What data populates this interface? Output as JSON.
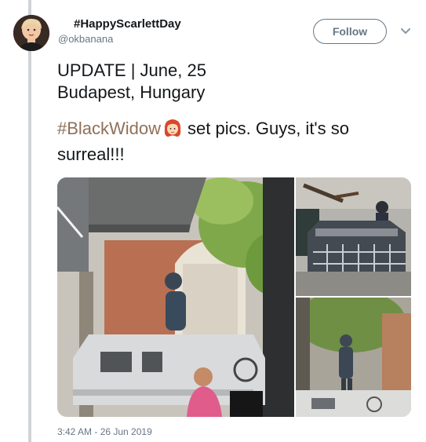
{
  "author": {
    "display_name": "#HappyScarlettDay",
    "handle": "@okbanana"
  },
  "follow_button": {
    "label": "Follow"
  },
  "tweet": {
    "line1": "UPDATE | June, 25",
    "line2": "Budapest, Hungary",
    "hashtag": "#BlackWidow",
    "line3_rest": "set pics. Guys, it's so",
    "line4": "surreal!!!"
  },
  "media": {
    "photos": [
      {
        "name": "photo-street-set"
      },
      {
        "name": "photo-vehicle-top"
      },
      {
        "name": "photo-vehicle-side"
      }
    ]
  },
  "timestamp": "3:42 AM - 26 Jun 2019",
  "icons": {
    "caret": "chevron-down-icon",
    "emoji": "red-haired-woman-emoji"
  },
  "colors": {
    "hashtag": "#8f7058",
    "secondary_text": "#657786",
    "thread_rail": "#d0d3d6"
  }
}
